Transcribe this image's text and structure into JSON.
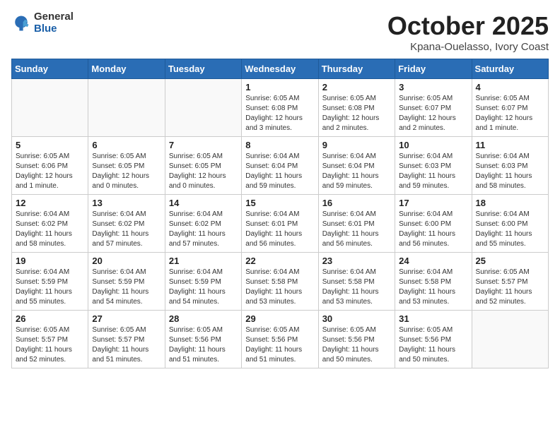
{
  "logo": {
    "general": "General",
    "blue": "Blue"
  },
  "title": "October 2025",
  "location": "Kpana-Ouelasso, Ivory Coast",
  "days_of_week": [
    "Sunday",
    "Monday",
    "Tuesday",
    "Wednesday",
    "Thursday",
    "Friday",
    "Saturday"
  ],
  "weeks": [
    [
      {
        "day": "",
        "info": ""
      },
      {
        "day": "",
        "info": ""
      },
      {
        "day": "",
        "info": ""
      },
      {
        "day": "1",
        "info": "Sunrise: 6:05 AM\nSunset: 6:08 PM\nDaylight: 12 hours\nand 3 minutes."
      },
      {
        "day": "2",
        "info": "Sunrise: 6:05 AM\nSunset: 6:08 PM\nDaylight: 12 hours\nand 2 minutes."
      },
      {
        "day": "3",
        "info": "Sunrise: 6:05 AM\nSunset: 6:07 PM\nDaylight: 12 hours\nand 2 minutes."
      },
      {
        "day": "4",
        "info": "Sunrise: 6:05 AM\nSunset: 6:07 PM\nDaylight: 12 hours\nand 1 minute."
      }
    ],
    [
      {
        "day": "5",
        "info": "Sunrise: 6:05 AM\nSunset: 6:06 PM\nDaylight: 12 hours\nand 1 minute."
      },
      {
        "day": "6",
        "info": "Sunrise: 6:05 AM\nSunset: 6:05 PM\nDaylight: 12 hours\nand 0 minutes."
      },
      {
        "day": "7",
        "info": "Sunrise: 6:05 AM\nSunset: 6:05 PM\nDaylight: 12 hours\nand 0 minutes."
      },
      {
        "day": "8",
        "info": "Sunrise: 6:04 AM\nSunset: 6:04 PM\nDaylight: 11 hours\nand 59 minutes."
      },
      {
        "day": "9",
        "info": "Sunrise: 6:04 AM\nSunset: 6:04 PM\nDaylight: 11 hours\nand 59 minutes."
      },
      {
        "day": "10",
        "info": "Sunrise: 6:04 AM\nSunset: 6:03 PM\nDaylight: 11 hours\nand 59 minutes."
      },
      {
        "day": "11",
        "info": "Sunrise: 6:04 AM\nSunset: 6:03 PM\nDaylight: 11 hours\nand 58 minutes."
      }
    ],
    [
      {
        "day": "12",
        "info": "Sunrise: 6:04 AM\nSunset: 6:02 PM\nDaylight: 11 hours\nand 58 minutes."
      },
      {
        "day": "13",
        "info": "Sunrise: 6:04 AM\nSunset: 6:02 PM\nDaylight: 11 hours\nand 57 minutes."
      },
      {
        "day": "14",
        "info": "Sunrise: 6:04 AM\nSunset: 6:02 PM\nDaylight: 11 hours\nand 57 minutes."
      },
      {
        "day": "15",
        "info": "Sunrise: 6:04 AM\nSunset: 6:01 PM\nDaylight: 11 hours\nand 56 minutes."
      },
      {
        "day": "16",
        "info": "Sunrise: 6:04 AM\nSunset: 6:01 PM\nDaylight: 11 hours\nand 56 minutes."
      },
      {
        "day": "17",
        "info": "Sunrise: 6:04 AM\nSunset: 6:00 PM\nDaylight: 11 hours\nand 56 minutes."
      },
      {
        "day": "18",
        "info": "Sunrise: 6:04 AM\nSunset: 6:00 PM\nDaylight: 11 hours\nand 55 minutes."
      }
    ],
    [
      {
        "day": "19",
        "info": "Sunrise: 6:04 AM\nSunset: 5:59 PM\nDaylight: 11 hours\nand 55 minutes."
      },
      {
        "day": "20",
        "info": "Sunrise: 6:04 AM\nSunset: 5:59 PM\nDaylight: 11 hours\nand 54 minutes."
      },
      {
        "day": "21",
        "info": "Sunrise: 6:04 AM\nSunset: 5:59 PM\nDaylight: 11 hours\nand 54 minutes."
      },
      {
        "day": "22",
        "info": "Sunrise: 6:04 AM\nSunset: 5:58 PM\nDaylight: 11 hours\nand 53 minutes."
      },
      {
        "day": "23",
        "info": "Sunrise: 6:04 AM\nSunset: 5:58 PM\nDaylight: 11 hours\nand 53 minutes."
      },
      {
        "day": "24",
        "info": "Sunrise: 6:04 AM\nSunset: 5:58 PM\nDaylight: 11 hours\nand 53 minutes."
      },
      {
        "day": "25",
        "info": "Sunrise: 6:05 AM\nSunset: 5:57 PM\nDaylight: 11 hours\nand 52 minutes."
      }
    ],
    [
      {
        "day": "26",
        "info": "Sunrise: 6:05 AM\nSunset: 5:57 PM\nDaylight: 11 hours\nand 52 minutes."
      },
      {
        "day": "27",
        "info": "Sunrise: 6:05 AM\nSunset: 5:57 PM\nDaylight: 11 hours\nand 51 minutes."
      },
      {
        "day": "28",
        "info": "Sunrise: 6:05 AM\nSunset: 5:56 PM\nDaylight: 11 hours\nand 51 minutes."
      },
      {
        "day": "29",
        "info": "Sunrise: 6:05 AM\nSunset: 5:56 PM\nDaylight: 11 hours\nand 51 minutes."
      },
      {
        "day": "30",
        "info": "Sunrise: 6:05 AM\nSunset: 5:56 PM\nDaylight: 11 hours\nand 50 minutes."
      },
      {
        "day": "31",
        "info": "Sunrise: 6:05 AM\nSunset: 5:56 PM\nDaylight: 11 hours\nand 50 minutes."
      },
      {
        "day": "",
        "info": ""
      }
    ]
  ]
}
